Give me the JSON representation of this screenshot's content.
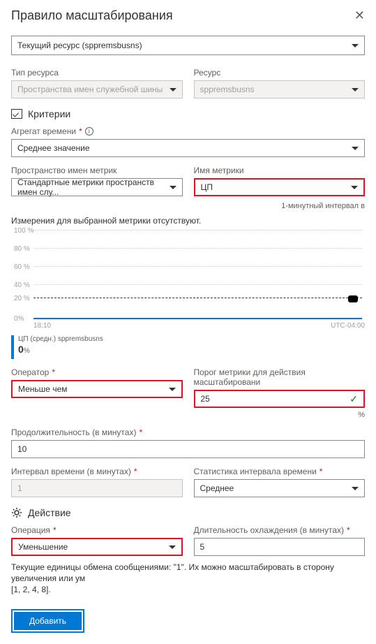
{
  "header": {
    "title": "Правило масштабирования"
  },
  "source": {
    "label": "Текущий ресурс (sppremsbusns)"
  },
  "resource_type": {
    "label": "Тип ресурса",
    "value": "Пространства имен служебной шины"
  },
  "resource": {
    "label": "Ресурс",
    "value": "sppremsbusns"
  },
  "criteria": {
    "title": "Критерии",
    "time_aggregate": {
      "label": "Агрегат времени",
      "value": "Среднее значение"
    },
    "metric_namespace": {
      "label": "Пространство имен метрик",
      "value": "Стандартные метрики пространств имен слу..."
    },
    "metric_name": {
      "label": "Имя метрики",
      "value": "ЦП"
    },
    "interval_note": "1-минутный интервал в",
    "dimensions_msg": "Измерения для выбранной метрики отсутствуют.",
    "operator": {
      "label": "Оператор",
      "value": "Меньше чем"
    },
    "threshold": {
      "label": "Порог метрики для действия масштабировани",
      "value": "25",
      "unit": "%"
    },
    "duration": {
      "label": "Продолжительность (в минутах)",
      "value": "10"
    },
    "time_grain": {
      "label": "Интервал времени (в минутах)",
      "value": "1"
    },
    "time_grain_stat": {
      "label": "Статистика интервала времени",
      "value": "Среднее"
    }
  },
  "chart_data": {
    "type": "line",
    "title": "",
    "ylabel": "%",
    "ylim": [
      0,
      100
    ],
    "y_ticks": [
      0,
      20,
      40,
      60,
      80,
      100
    ],
    "threshold_line": 25,
    "x_ticks": [
      "18:10",
      "UTC-04:00"
    ],
    "series": [
      {
        "name": "ЦП (средн.) sppremsbusns",
        "values": [
          0
        ],
        "current": "0",
        "unit": "%",
        "color": "#0078d4"
      }
    ]
  },
  "action": {
    "title": "Действие",
    "operation": {
      "label": "Операция",
      "value": "Уменьшение"
    },
    "cooldown": {
      "label": "Длительность охлаждения (в минутах)",
      "value": "5"
    },
    "scale_note": "Текущие единицы обмена сообщениями: \"1\". Их можно масштабировать в сторону увеличения или ум",
    "scale_values": "[1, 2, 4, 8]."
  },
  "buttons": {
    "add": "Добавить"
  }
}
